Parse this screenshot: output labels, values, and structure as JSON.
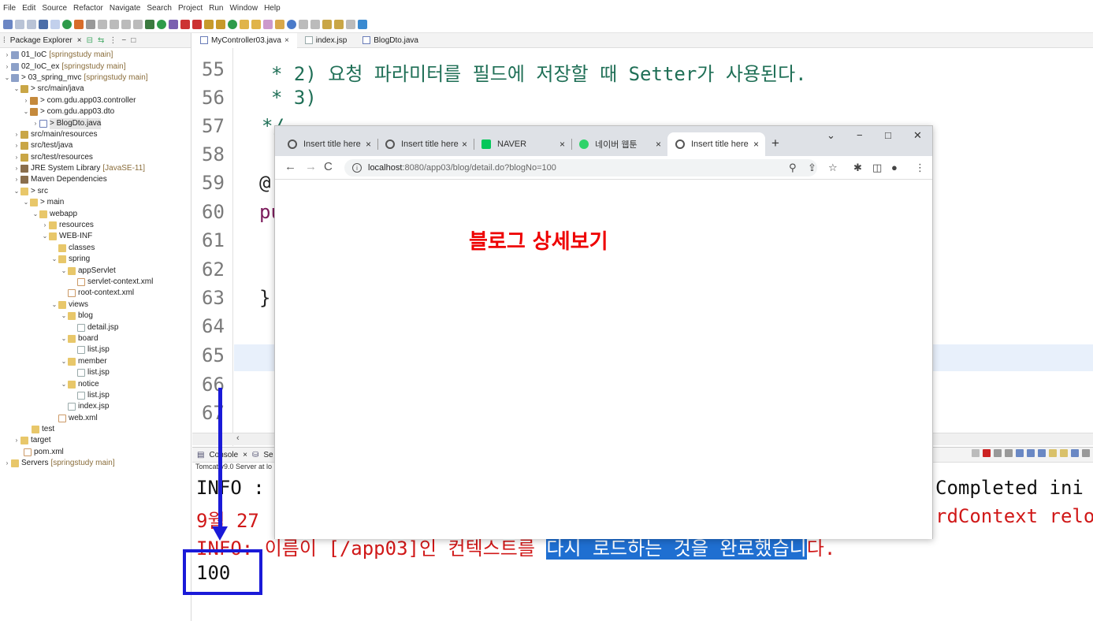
{
  "menu": [
    "File",
    "Edit",
    "Source",
    "Refactor",
    "Navigate",
    "Search",
    "Project",
    "Run",
    "Window",
    "Help"
  ],
  "package_explorer": {
    "title": "Package Explorer",
    "items": [
      {
        "label": "01_IoC",
        "dec": "[springstudy main]"
      },
      {
        "label": "02_IoC_ex",
        "dec": "[springstudy main]"
      },
      {
        "label": "> 03_spring_mvc",
        "dec": "[springstudy main]"
      },
      {
        "label": "> src/main/java",
        "dec": ""
      },
      {
        "label": "> com.gdu.app03.controller",
        "dec": ""
      },
      {
        "label": "> com.gdu.app03.dto",
        "dec": ""
      },
      {
        "label": "> BlogDto.java",
        "dec": ""
      },
      {
        "label": "src/main/resources",
        "dec": ""
      },
      {
        "label": "src/test/java",
        "dec": ""
      },
      {
        "label": "src/test/resources",
        "dec": ""
      },
      {
        "label": "JRE System Library",
        "dec": "[JavaSE-11]"
      },
      {
        "label": "Maven Dependencies",
        "dec": ""
      },
      {
        "label": "> src",
        "dec": ""
      },
      {
        "label": "> main",
        "dec": ""
      },
      {
        "label": "webapp",
        "dec": ""
      },
      {
        "label": "resources",
        "dec": ""
      },
      {
        "label": "WEB-INF",
        "dec": ""
      },
      {
        "label": "classes",
        "dec": ""
      },
      {
        "label": "spring",
        "dec": ""
      },
      {
        "label": "appServlet",
        "dec": ""
      },
      {
        "label": "servlet-context.xml",
        "dec": ""
      },
      {
        "label": "root-context.xml",
        "dec": ""
      },
      {
        "label": "views",
        "dec": ""
      },
      {
        "label": "blog",
        "dec": ""
      },
      {
        "label": "detail.jsp",
        "dec": ""
      },
      {
        "label": "board",
        "dec": ""
      },
      {
        "label": "list.jsp",
        "dec": ""
      },
      {
        "label": "member",
        "dec": ""
      },
      {
        "label": "list.jsp",
        "dec": ""
      },
      {
        "label": "notice",
        "dec": ""
      },
      {
        "label": "list.jsp",
        "dec": ""
      },
      {
        "label": "index.jsp",
        "dec": ""
      },
      {
        "label": "web.xml",
        "dec": ""
      },
      {
        "label": "test",
        "dec": ""
      },
      {
        "label": "target",
        "dec": ""
      },
      {
        "label": "pom.xml",
        "dec": ""
      },
      {
        "label": "Servers",
        "dec": "[springstudy main]"
      }
    ]
  },
  "editor": {
    "tabs": [
      "MyController03.java",
      "index.jsp",
      "BlogDto.java"
    ],
    "line_numbers": [
      "55",
      "56",
      "57",
      "58",
      "59",
      "60",
      "61",
      "62",
      "63",
      "64",
      "65",
      "66",
      "67"
    ],
    "lines": {
      "l55": "*  2) 요청 파라미터를 필드에 저장할 때 Setter가 사용된다.",
      "l56": "*  3)",
      "l57": "*/",
      "l59": "@",
      "l60": "pu",
      "l63": "}"
    }
  },
  "console": {
    "tab": "Console",
    "tab2": "Se",
    "server": "Tomcat v9.0 Server at lo",
    "line1_left": "INFO :",
    "line1_right": "Completed ini",
    "line2_left": "9월 27",
    "line2_right": "rdContext relo",
    "line3_pre": "INFO: 이름이 [/app03]인 컨텍스트를 ",
    "line3_hl": "다시 로드하는 것을 완료했습니",
    "line3_post": "다.",
    "output": "100"
  },
  "browser": {
    "tabs": [
      {
        "title": "Insert title here"
      },
      {
        "title": "Insert title here"
      },
      {
        "title": "NAVER"
      },
      {
        "title": "네이버 웹툰"
      },
      {
        "title": "Insert title here"
      }
    ],
    "url_host": "localhost",
    "url_path": ":8080/app03/blog/detail.do?blogNo=100",
    "heading": "블로그 상세보기"
  },
  "colors": {
    "annotation": "#1a1ad8",
    "heading": "#ee0000",
    "code_comment": "#1f6f56",
    "console_red": "#d01818",
    "selection": "#1f6fd1"
  }
}
